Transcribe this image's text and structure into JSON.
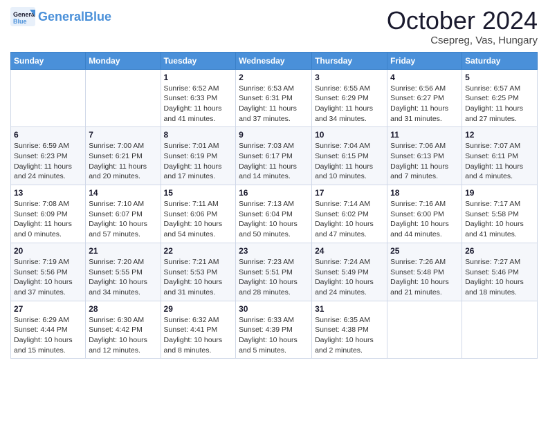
{
  "logo": {
    "text_general": "General",
    "text_blue": "Blue"
  },
  "header": {
    "month": "October 2024",
    "location": "Csepreg, Vas, Hungary"
  },
  "weekdays": [
    "Sunday",
    "Monday",
    "Tuesday",
    "Wednesday",
    "Thursday",
    "Friday",
    "Saturday"
  ],
  "weeks": [
    [
      {
        "day": "",
        "sunrise": "",
        "sunset": "",
        "daylight": ""
      },
      {
        "day": "",
        "sunrise": "",
        "sunset": "",
        "daylight": ""
      },
      {
        "day": "1",
        "sunrise": "Sunrise: 6:52 AM",
        "sunset": "Sunset: 6:33 PM",
        "daylight": "Daylight: 11 hours and 41 minutes."
      },
      {
        "day": "2",
        "sunrise": "Sunrise: 6:53 AM",
        "sunset": "Sunset: 6:31 PM",
        "daylight": "Daylight: 11 hours and 37 minutes."
      },
      {
        "day": "3",
        "sunrise": "Sunrise: 6:55 AM",
        "sunset": "Sunset: 6:29 PM",
        "daylight": "Daylight: 11 hours and 34 minutes."
      },
      {
        "day": "4",
        "sunrise": "Sunrise: 6:56 AM",
        "sunset": "Sunset: 6:27 PM",
        "daylight": "Daylight: 11 hours and 31 minutes."
      },
      {
        "day": "5",
        "sunrise": "Sunrise: 6:57 AM",
        "sunset": "Sunset: 6:25 PM",
        "daylight": "Daylight: 11 hours and 27 minutes."
      }
    ],
    [
      {
        "day": "6",
        "sunrise": "Sunrise: 6:59 AM",
        "sunset": "Sunset: 6:23 PM",
        "daylight": "Daylight: 11 hours and 24 minutes."
      },
      {
        "day": "7",
        "sunrise": "Sunrise: 7:00 AM",
        "sunset": "Sunset: 6:21 PM",
        "daylight": "Daylight: 11 hours and 20 minutes."
      },
      {
        "day": "8",
        "sunrise": "Sunrise: 7:01 AM",
        "sunset": "Sunset: 6:19 PM",
        "daylight": "Daylight: 11 hours and 17 minutes."
      },
      {
        "day": "9",
        "sunrise": "Sunrise: 7:03 AM",
        "sunset": "Sunset: 6:17 PM",
        "daylight": "Daylight: 11 hours and 14 minutes."
      },
      {
        "day": "10",
        "sunrise": "Sunrise: 7:04 AM",
        "sunset": "Sunset: 6:15 PM",
        "daylight": "Daylight: 11 hours and 10 minutes."
      },
      {
        "day": "11",
        "sunrise": "Sunrise: 7:06 AM",
        "sunset": "Sunset: 6:13 PM",
        "daylight": "Daylight: 11 hours and 7 minutes."
      },
      {
        "day": "12",
        "sunrise": "Sunrise: 7:07 AM",
        "sunset": "Sunset: 6:11 PM",
        "daylight": "Daylight: 11 hours and 4 minutes."
      }
    ],
    [
      {
        "day": "13",
        "sunrise": "Sunrise: 7:08 AM",
        "sunset": "Sunset: 6:09 PM",
        "daylight": "Daylight: 11 hours and 0 minutes."
      },
      {
        "day": "14",
        "sunrise": "Sunrise: 7:10 AM",
        "sunset": "Sunset: 6:07 PM",
        "daylight": "Daylight: 10 hours and 57 minutes."
      },
      {
        "day": "15",
        "sunrise": "Sunrise: 7:11 AM",
        "sunset": "Sunset: 6:06 PM",
        "daylight": "Daylight: 10 hours and 54 minutes."
      },
      {
        "day": "16",
        "sunrise": "Sunrise: 7:13 AM",
        "sunset": "Sunset: 6:04 PM",
        "daylight": "Daylight: 10 hours and 50 minutes."
      },
      {
        "day": "17",
        "sunrise": "Sunrise: 7:14 AM",
        "sunset": "Sunset: 6:02 PM",
        "daylight": "Daylight: 10 hours and 47 minutes."
      },
      {
        "day": "18",
        "sunrise": "Sunrise: 7:16 AM",
        "sunset": "Sunset: 6:00 PM",
        "daylight": "Daylight: 10 hours and 44 minutes."
      },
      {
        "day": "19",
        "sunrise": "Sunrise: 7:17 AM",
        "sunset": "Sunset: 5:58 PM",
        "daylight": "Daylight: 10 hours and 41 minutes."
      }
    ],
    [
      {
        "day": "20",
        "sunrise": "Sunrise: 7:19 AM",
        "sunset": "Sunset: 5:56 PM",
        "daylight": "Daylight: 10 hours and 37 minutes."
      },
      {
        "day": "21",
        "sunrise": "Sunrise: 7:20 AM",
        "sunset": "Sunset: 5:55 PM",
        "daylight": "Daylight: 10 hours and 34 minutes."
      },
      {
        "day": "22",
        "sunrise": "Sunrise: 7:21 AM",
        "sunset": "Sunset: 5:53 PM",
        "daylight": "Daylight: 10 hours and 31 minutes."
      },
      {
        "day": "23",
        "sunrise": "Sunrise: 7:23 AM",
        "sunset": "Sunset: 5:51 PM",
        "daylight": "Daylight: 10 hours and 28 minutes."
      },
      {
        "day": "24",
        "sunrise": "Sunrise: 7:24 AM",
        "sunset": "Sunset: 5:49 PM",
        "daylight": "Daylight: 10 hours and 24 minutes."
      },
      {
        "day": "25",
        "sunrise": "Sunrise: 7:26 AM",
        "sunset": "Sunset: 5:48 PM",
        "daylight": "Daylight: 10 hours and 21 minutes."
      },
      {
        "day": "26",
        "sunrise": "Sunrise: 7:27 AM",
        "sunset": "Sunset: 5:46 PM",
        "daylight": "Daylight: 10 hours and 18 minutes."
      }
    ],
    [
      {
        "day": "27",
        "sunrise": "Sunrise: 6:29 AM",
        "sunset": "Sunset: 4:44 PM",
        "daylight": "Daylight: 10 hours and 15 minutes."
      },
      {
        "day": "28",
        "sunrise": "Sunrise: 6:30 AM",
        "sunset": "Sunset: 4:42 PM",
        "daylight": "Daylight: 10 hours and 12 minutes."
      },
      {
        "day": "29",
        "sunrise": "Sunrise: 6:32 AM",
        "sunset": "Sunset: 4:41 PM",
        "daylight": "Daylight: 10 hours and 8 minutes."
      },
      {
        "day": "30",
        "sunrise": "Sunrise: 6:33 AM",
        "sunset": "Sunset: 4:39 PM",
        "daylight": "Daylight: 10 hours and 5 minutes."
      },
      {
        "day": "31",
        "sunrise": "Sunrise: 6:35 AM",
        "sunset": "Sunset: 4:38 PM",
        "daylight": "Daylight: 10 hours and 2 minutes."
      },
      {
        "day": "",
        "sunrise": "",
        "sunset": "",
        "daylight": ""
      },
      {
        "day": "",
        "sunrise": "",
        "sunset": "",
        "daylight": ""
      }
    ]
  ]
}
